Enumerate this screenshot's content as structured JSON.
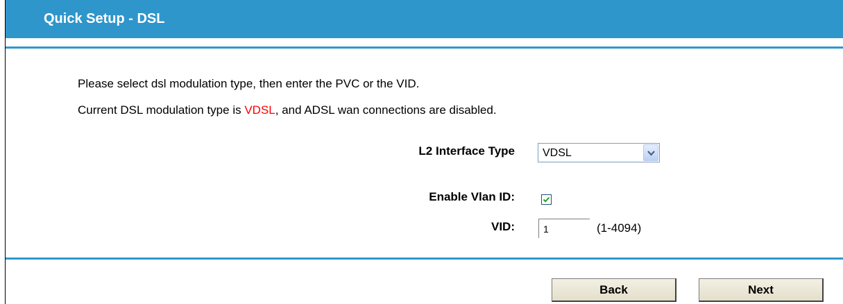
{
  "header": {
    "title": "Quick Setup - DSL"
  },
  "instructions": {
    "line1": "Please select dsl modulation type, then enter the PVC or the VID.",
    "line2_prefix": "Current DSL modulation type is ",
    "line2_highlight": "VDSL",
    "line2_suffix": ", and ADSL wan connections are disabled."
  },
  "form": {
    "l2_interface_type": {
      "label": "L2 Interface Type",
      "selected": "VDSL"
    },
    "enable_vlan_id": {
      "label": "Enable Vlan ID:",
      "checked": true
    },
    "vid": {
      "label": "VID:",
      "value": "1",
      "range_hint": "(1-4094)"
    }
  },
  "buttons": {
    "back_label": "Back",
    "next_label": "Next"
  },
  "colors": {
    "accent": "#2f96cb",
    "highlight": "#ff0000"
  },
  "icons": {
    "dropdown": "chevron-down-icon",
    "checkbox": "checkmark-icon"
  }
}
